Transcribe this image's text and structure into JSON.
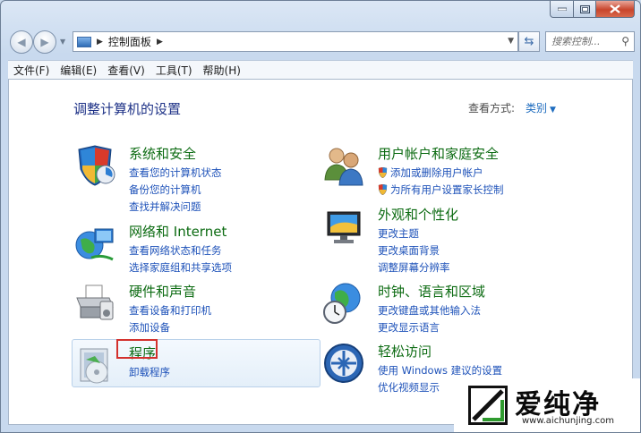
{
  "window": {
    "colors": {
      "link": "#1e52b9",
      "heading": "#0c6b12",
      "title": "#1e3287",
      "highlight": "#d3312d"
    }
  },
  "nav": {
    "breadcrumb": "控制面板",
    "search_placeholder": "搜索控制..."
  },
  "menu": [
    "文件(F)",
    "编辑(E)",
    "查看(V)",
    "工具(T)",
    "帮助(H)"
  ],
  "page": {
    "title": "调整计算机的设置",
    "view_by_label": "查看方式:",
    "view_by_value": "类别"
  },
  "categories": [
    {
      "title": "系统和安全",
      "icon": "security-shield-icon",
      "links": [
        "查看您的计算机状态",
        "备份您的计算机",
        "查找并解决问题"
      ]
    },
    {
      "title": "网络和 Internet",
      "icon": "network-globe-icon",
      "links": [
        "查看网络状态和任务",
        "选择家庭组和共享选项"
      ]
    },
    {
      "title": "硬件和声音",
      "icon": "printer-icon",
      "links": [
        "查看设备和打印机",
        "添加设备"
      ]
    },
    {
      "title": "程序",
      "icon": "programs-icon",
      "links": [
        "卸载程序"
      ]
    },
    {
      "title": "用户帐户和家庭安全",
      "icon": "users-icon",
      "links": [
        "添加或删除用户帐户",
        "为所有用户设置家长控制"
      ]
    },
    {
      "title": "外观和个性化",
      "icon": "monitor-icon",
      "links": [
        "更改主题",
        "更改桌面背景",
        "调整屏幕分辨率"
      ]
    },
    {
      "title": "时钟、语言和区域",
      "icon": "clock-globe-icon",
      "links": [
        "更改键盘或其他输入法",
        "更改显示语言"
      ]
    },
    {
      "title": "轻松访问",
      "icon": "ease-of-access-icon",
      "links": [
        "使用 Windows 建议的设置",
        "优化视频显示"
      ]
    }
  ],
  "watermark": {
    "name": "爱纯净",
    "url": "www.aichunjing.com"
  }
}
